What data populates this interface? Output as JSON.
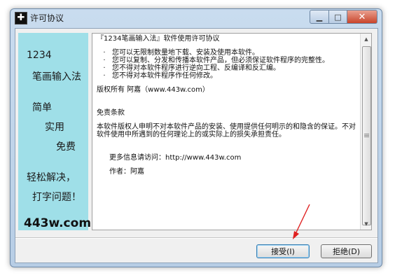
{
  "window": {
    "title": "许可协议"
  },
  "banner": {
    "num": "1234",
    "name": "笔画输入法",
    "w1": "简单",
    "w2": "实用",
    "w3": "免费",
    "s1": "轻松解决，",
    "s2": "打字问题！",
    "site": "443w.com"
  },
  "license": {
    "heading": "『1234笔画输入法』软件使用许可协议",
    "bullets": [
      "您可以无限制数量地下载、安装及使用本软件。",
      "您可以复制、分发和传播本软件产品，但必须保证软件程序的完整性。",
      "您不得对本软件程序进行逆向工程、反编译和反汇编。",
      "您不得对本软件程序作任何修改。"
    ],
    "copyright": "版权所有 阿嘉（www.443w.com）",
    "disclaimer_title": "免责条款",
    "disclaimer": "本软件版权人申明不对本软件产品的安装、使用提供任何明示的和隐含的保证。不对软件使用中所遇到的任何理论上的或实际上的损失承担责任。",
    "more_info": "更多信息请访问：http://www.443w.com",
    "author": "作者：阿嘉"
  },
  "buttons": {
    "accept": "接受(I)",
    "reject": "拒绝(D)"
  },
  "colors": {
    "banner_bg": "#9fdfe8",
    "annotation_arrow": "#e02020"
  }
}
